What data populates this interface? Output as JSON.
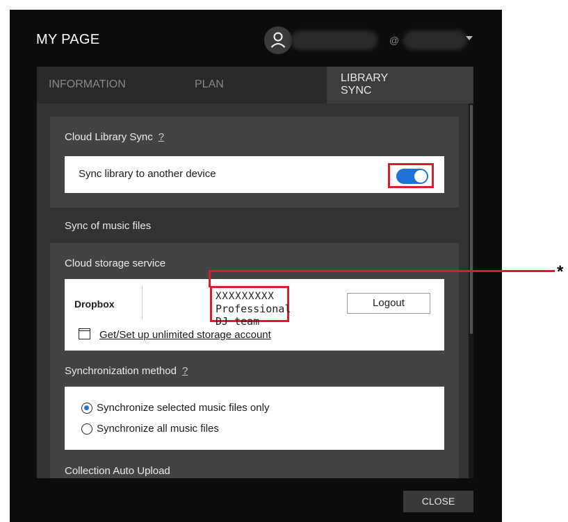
{
  "window": {
    "title": "MY PAGE"
  },
  "account": {
    "visible_fragment": "@"
  },
  "tabs": [
    {
      "label": "INFORMATION",
      "active": false
    },
    {
      "label": "PLAN",
      "active": false
    },
    {
      "label": "LIBRARY SYNC",
      "active": true
    }
  ],
  "cloud_library_sync": {
    "title": "Cloud Library Sync",
    "help": "?",
    "sync_label": "Sync library to another device",
    "sync_enabled": true
  },
  "music_files": {
    "title": "Sync of music files"
  },
  "cloud_storage": {
    "title": "Cloud storage service",
    "service": "Dropbox",
    "account_id": "XXXXXXXXX",
    "account_team": "Professional DJ team",
    "logout_label": "Logout",
    "link_label": "Get/Set up unlimited storage account"
  },
  "sync_method": {
    "title": "Synchronization method",
    "help": "?",
    "options": [
      {
        "label": "Synchronize selected music files only",
        "selected": true
      },
      {
        "label": "Synchronize all music files",
        "selected": false
      }
    ]
  },
  "auto_upload": {
    "title": "Collection Auto Upload"
  },
  "footer": {
    "close_label": "CLOSE"
  },
  "annotation": {
    "marker": "*"
  },
  "colors": {
    "accent": "#1e73d6",
    "highlight": "#d51e2e",
    "background": "#0d0d0d",
    "panel": "#333333"
  },
  "icons": {
    "avatar": "user-icon",
    "dropdown": "chevron-down-icon",
    "link": "window-icon"
  }
}
